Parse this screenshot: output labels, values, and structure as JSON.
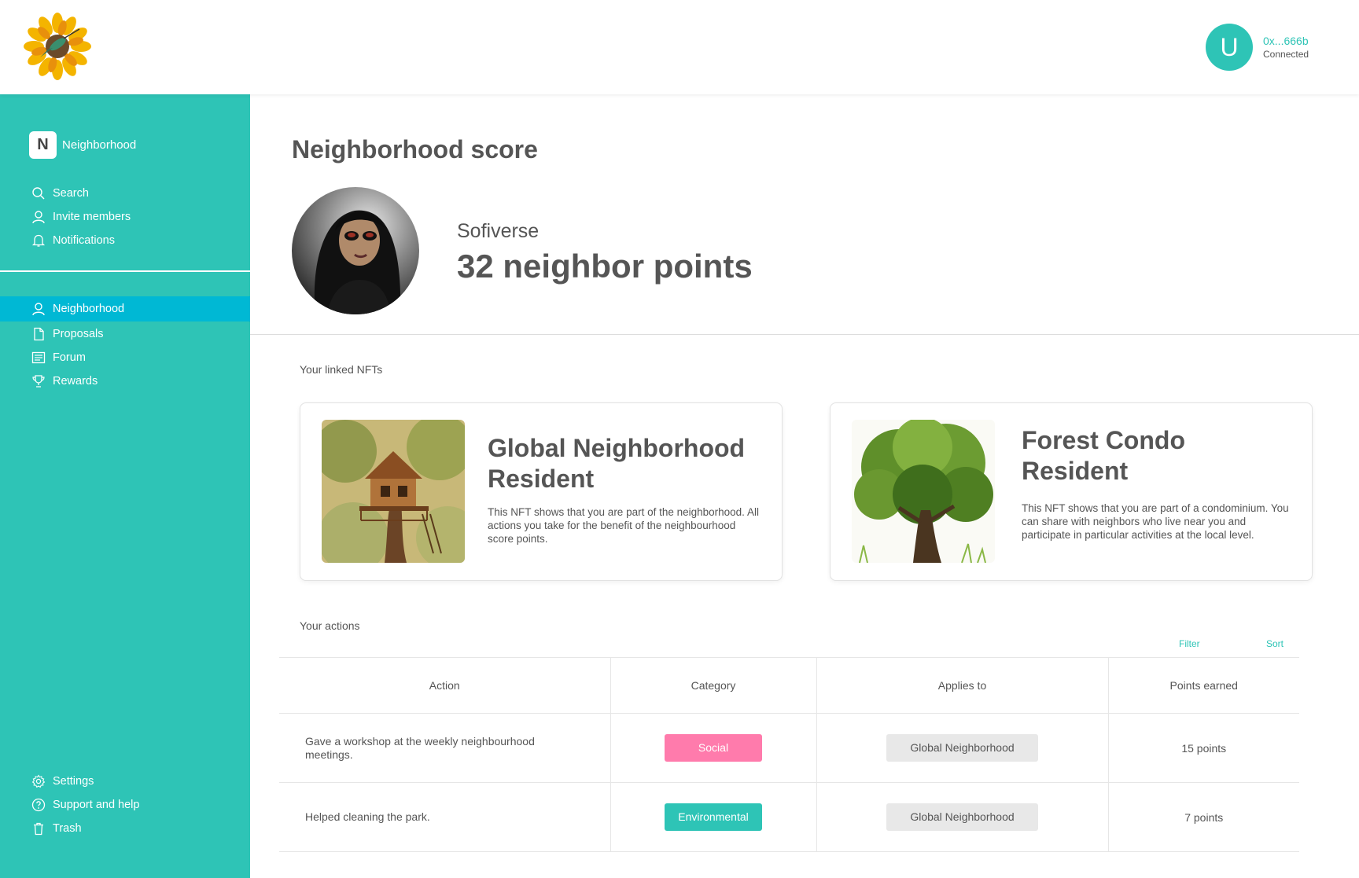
{
  "header": {
    "user_initial": "U",
    "wallet_address": "0x...666b",
    "connection_status": "Connected"
  },
  "sidebar": {
    "workspace_initial": "N",
    "workspace_name": "Neighborhood",
    "top_items": [
      {
        "label": "Search",
        "icon": "search-icon"
      },
      {
        "label": "Invite members",
        "icon": "user-icon"
      },
      {
        "label": "Notifications",
        "icon": "bell-icon"
      }
    ],
    "nav_items": [
      {
        "label": "Neighborhood",
        "icon": "user-icon",
        "active": true
      },
      {
        "label": "Proposals",
        "icon": "document-icon"
      },
      {
        "label": "Forum",
        "icon": "forum-icon"
      },
      {
        "label": "Rewards",
        "icon": "trophy-icon"
      }
    ],
    "bottom_items": [
      {
        "label": "Settings",
        "icon": "gear-icon"
      },
      {
        "label": "Support and help",
        "icon": "help-icon"
      },
      {
        "label": "Trash",
        "icon": "trash-icon"
      }
    ]
  },
  "main": {
    "page_title": "Neighborhood score",
    "profile": {
      "name": "Sofiverse",
      "points": "32 neighbor points"
    },
    "linked_nfts_label": "Your linked NFTs",
    "nfts": [
      {
        "title": "Global Neighborhood Resident",
        "description": "This NFT shows that you are part of the neighborhood. All actions you take for the benefit of the neighbourhood score points."
      },
      {
        "title": "Forest Condo Resident",
        "description": "This NFT shows that you are part of a condominium. You can share with neighbors who live near you and participate in particular activities at the local level."
      }
    ],
    "actions_label": "Your actions",
    "filter_label": "Filter",
    "sort_label": "Sort",
    "table": {
      "columns": [
        "Action",
        "Category",
        "Applies to",
        "Points earned"
      ],
      "rows": [
        {
          "action": "Gave a workshop at the weekly neighbourhood meetings.",
          "category": "Social",
          "category_color": "#ff7bac",
          "applies_to": "Global Neighborhood",
          "points": "15 points"
        },
        {
          "action": "Helped cleaning the park.",
          "category": "Environmental",
          "category_color": "#2ec4b6",
          "applies_to": "Global Neighborhood",
          "points": "7 points"
        }
      ]
    }
  },
  "colors": {
    "accent": "#2ec4b6",
    "active_nav": "#00b8d4",
    "social": "#ff7bac"
  }
}
